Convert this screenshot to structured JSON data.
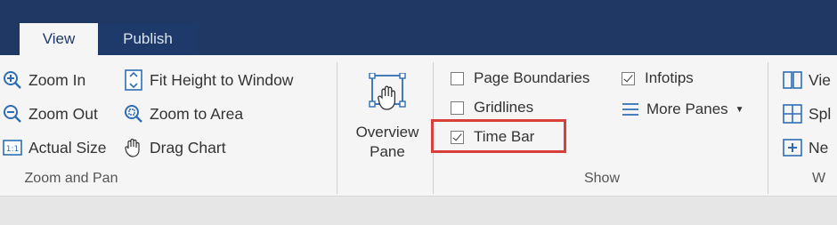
{
  "tabs": [
    {
      "label": "View",
      "active": true
    },
    {
      "label": "Publish",
      "active": false
    }
  ],
  "zoom_and_pan": {
    "group_label": "Zoom and Pan",
    "zoom_in": "Zoom In",
    "zoom_out": "Zoom Out",
    "actual_size": "Actual Size",
    "fit_height": "Fit Height to Window",
    "zoom_to_area": "Zoom to Area",
    "drag_chart": "Drag Chart"
  },
  "overview": {
    "line1": "Overview",
    "line2": "Pane"
  },
  "show": {
    "group_label": "Show",
    "page_boundaries": {
      "label": "Page Boundaries",
      "checked": false
    },
    "gridlines": {
      "label": "Gridlines",
      "checked": false
    },
    "time_bar": {
      "label": "Time Bar",
      "checked": true
    },
    "infotips": {
      "label": "Infotips",
      "checked": true
    },
    "more_panes": "More Panes"
  },
  "window_group": {
    "view_partial": "Vie",
    "split_partial": "Spl",
    "new_partial": "Ne",
    "group_label_partial": "W"
  },
  "colors": {
    "titlebar": "#1f3864",
    "icon_blue": "#2e6db4",
    "highlight": "#d9403a"
  }
}
